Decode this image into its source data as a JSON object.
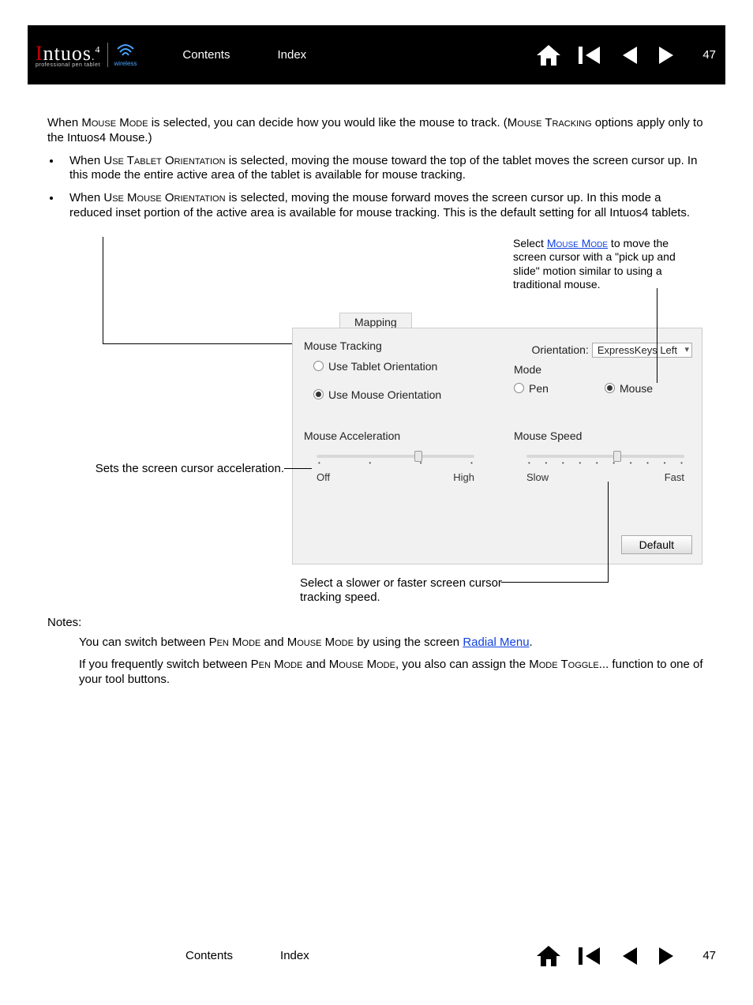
{
  "header": {
    "logo_brand_i": "I",
    "logo_brand_rest": "ntuos",
    "logo_four": "4",
    "logo_subtitle": "professional pen tablet",
    "wireless_label": "wireless",
    "contents": "Contents",
    "index": "Index",
    "page_number": "47"
  },
  "intro": {
    "p1_a": "When ",
    "p1_sc1": "Mouse Mode",
    "p1_b": " is selected, you can decide how you would like the mouse to track.  (",
    "p1_sc2": "Mouse Tracking",
    "p1_c": " options apply only to the Intuos4 Mouse.)",
    "b1_a": "When ",
    "b1_sc": "Use Tablet Orientation",
    "b1_b": " is selected, moving the mouse toward the top of the tablet moves the screen cursor up.  In this mode the entire active area of the tablet is available for mouse tracking.",
    "b2_a": "When ",
    "b2_sc": "Use Mouse Orientation",
    "b2_b": " is selected, moving the mouse forward moves the screen cursor up.  In this mode a reduced inset portion of the active area is available for mouse tracking.  This is the default setting for all Intuos4 tablets."
  },
  "panel": {
    "tab": "Mapping",
    "group_tracking": "Mouse Tracking",
    "radio_tablet": "Use Tablet Orientation",
    "radio_mouse": "Use Mouse Orientation",
    "orientation_label": "Orientation:",
    "orientation_value": "ExpressKeys Left",
    "group_mode": "Mode",
    "radio_pen": "Pen",
    "radio_mouse_mode": "Mouse",
    "group_accel": "Mouse Acceleration",
    "accel_left": "Off",
    "accel_right": "High",
    "group_speed": "Mouse Speed",
    "speed_left": "Slow",
    "speed_right": "Fast",
    "default_btn": "Default"
  },
  "callouts": {
    "a_pre": "Select ",
    "a_link": "Mouse Mode",
    "a_post": " to move the screen cursor with a \"pick up and slide\" motion similar to using a traditional mouse.",
    "b": "Sets the screen cursor acceleration.",
    "c": "Select a slower or faster screen cursor tracking speed."
  },
  "notes": {
    "heading": "Notes:",
    "n1_a": "You can switch between ",
    "n1_sc1": "Pen Mode",
    "n1_b": " and ",
    "n1_sc2": "Mouse Mode",
    "n1_c": " by using the screen ",
    "n1_link": "Radial Menu",
    "n1_d": ".",
    "n2_a": "If you frequently switch between ",
    "n2_sc1": "Pen Mode",
    "n2_b": " and ",
    "n2_sc2": "Mouse Mode",
    "n2_c": ", you also can assign the ",
    "n2_sc3": "Mode Toggle",
    "n2_d": "... function to one of your tool buttons."
  }
}
